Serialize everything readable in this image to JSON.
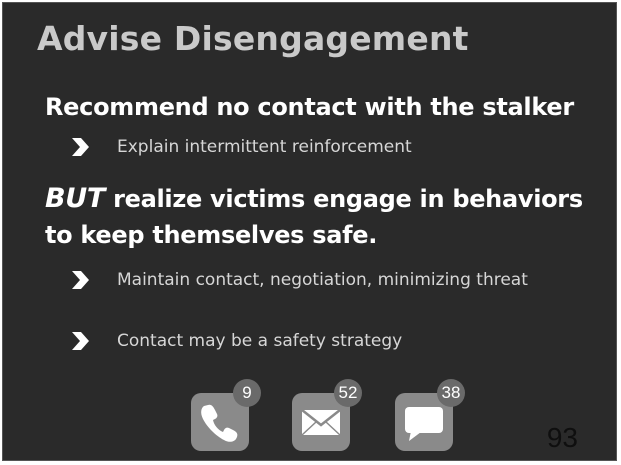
{
  "slide": {
    "title": "Advise Disengagement",
    "sections": [
      {
        "heading": "Recommend no contact with the stalker",
        "bullets": [
          "Explain intermittent reinforcement"
        ]
      },
      {
        "heading_lead": "BUT",
        "heading_rest": " realize victims engage in behaviors to keep themselves safe.",
        "bullets": [
          "Maintain contact, negotiation, minimizing threat",
          "Contact may be a safety strategy"
        ]
      }
    ],
    "bullet_icon": "chevron-right-icon",
    "dock": {
      "phone": {
        "icon": "phone-icon",
        "badge": "9"
      },
      "mail": {
        "icon": "mail-icon",
        "badge": "52"
      },
      "messages": {
        "icon": "chat-bubble-icon",
        "badge": "38"
      }
    },
    "page_number": "93"
  }
}
